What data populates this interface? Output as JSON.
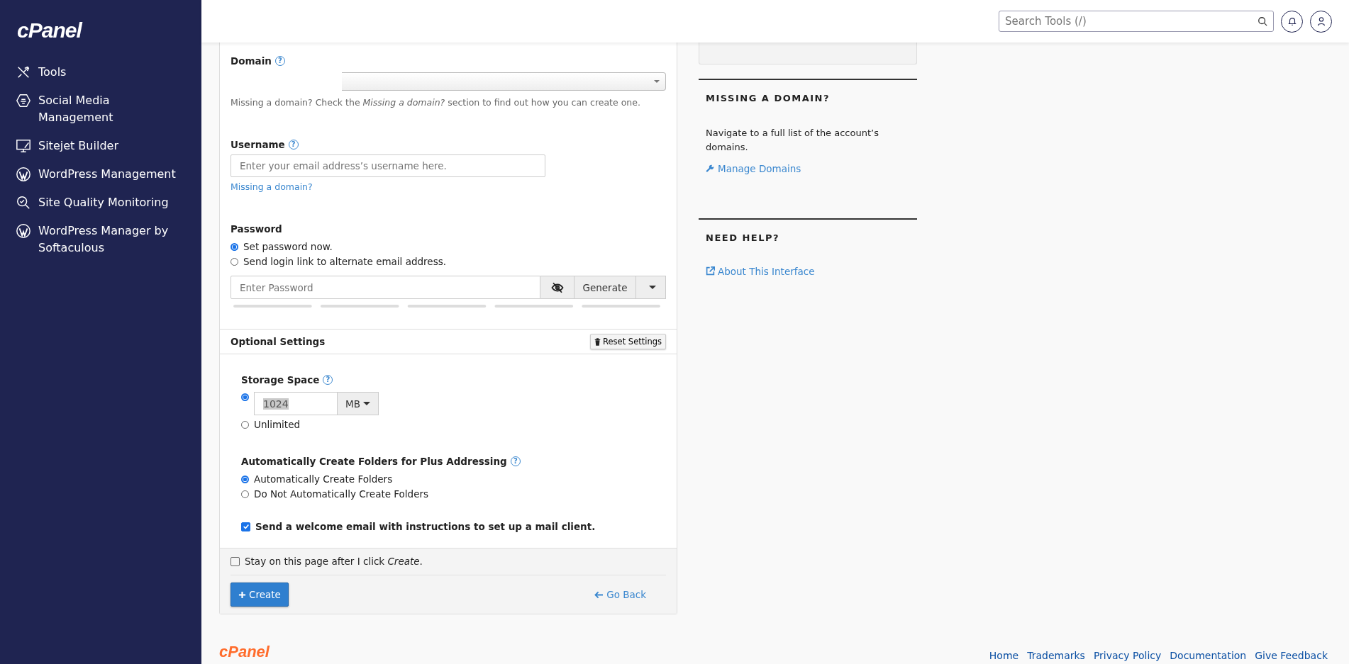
{
  "sidebar": {
    "logo": "cPanel",
    "items": [
      {
        "label": "Tools",
        "kind": "tools"
      },
      {
        "label": "Social Media Management",
        "kind": "social"
      },
      {
        "label": "Sitejet Builder",
        "kind": "sitejet"
      },
      {
        "label": "WordPress Management",
        "kind": "wordpress"
      },
      {
        "label": "Site Quality Monitoring",
        "kind": "quality"
      },
      {
        "label": "WordPress Manager by Softaculous",
        "kind": "wordpress"
      }
    ]
  },
  "header": {
    "search": {
      "placeholder": "Search Tools (/)"
    }
  },
  "form": {
    "domain": {
      "label": "Domain",
      "help": "?",
      "hint": "Missing a domain? Check the *Missing a domain?* section to find out how you can create one."
    },
    "username": {
      "label": "Username",
      "help": "?",
      "placeholder": "Enter your email address’s username here.",
      "link": "Missing a domain?"
    },
    "password": {
      "label": "Password",
      "options": [
        {
          "label": "Set password now.",
          "selected": true
        },
        {
          "label": "Send login link to alternate email address.",
          "selected": false
        }
      ],
      "placeholder": "Enter Password",
      "generate": "Generate"
    },
    "optional": {
      "title": "Optional Settings",
      "reset": "Reset Settings",
      "storage": {
        "label": "Storage Space",
        "help": "?",
        "options": [
          {
            "kind": "quota",
            "selected": true,
            "value": "1024",
            "unit": "MB"
          },
          {
            "kind": "unlimited",
            "label": "Unlimited",
            "selected": false
          }
        ]
      },
      "folders": {
        "label": "Automatically Create Folders for Plus Addressing",
        "help": "?",
        "options": [
          {
            "label": "Automatically Create Folders",
            "selected": true
          },
          {
            "label": "Do Not Automatically Create Folders",
            "selected": false
          }
        ]
      },
      "welcome": {
        "label": "Send a welcome email with instructions to set up a mail client.",
        "checked": true
      }
    },
    "stay": {
      "label": "Stay on this page after I click *Create*.",
      "checked": false
    },
    "create": "Create",
    "back": "Go Back"
  },
  "aside": {
    "sections": [
      {
        "title": "MISSING A DOMAIN?",
        "text": "Navigate to a full list of the account’s domains.",
        "link": {
          "label": "Manage Domains",
          "kind": "wrench"
        }
      },
      {
        "title": "NEED HELP?",
        "link": {
          "label": "About This Interface",
          "kind": "external"
        }
      }
    ]
  },
  "footer": {
    "logo": "cPanel",
    "links": [
      "Home",
      "Trademarks",
      "Privacy Policy",
      "Documentation",
      "Give Feedback"
    ]
  }
}
